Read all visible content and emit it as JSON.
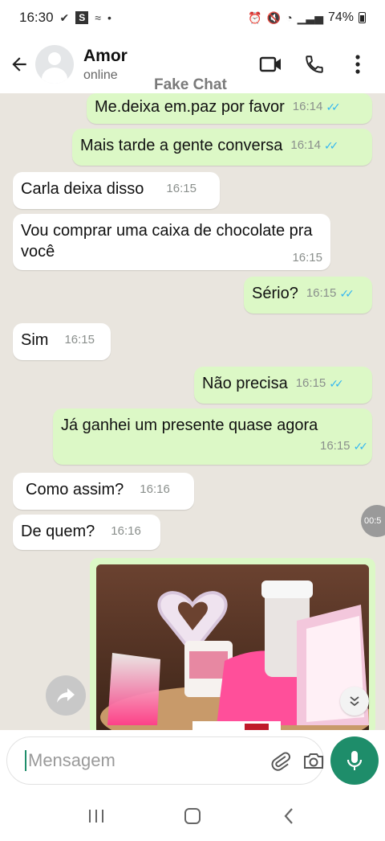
{
  "status_bar": {
    "time": "16:30",
    "battery": "74%"
  },
  "header": {
    "contact_name": "Amor",
    "contact_status": "online",
    "watermark": "Fake Chat"
  },
  "messages": [
    {
      "direction": "out",
      "text": "Me.deixa em.paz por favor",
      "time": "16:14",
      "read": true
    },
    {
      "direction": "out",
      "text": "Mais tarde a gente conversa",
      "time": "16:14",
      "read": true
    },
    {
      "direction": "in",
      "text": "Carla deixa disso",
      "time": "16:15"
    },
    {
      "direction": "in",
      "text": "Vou comprar uma caixa de chocolate pra você",
      "time": "16:15"
    },
    {
      "direction": "out",
      "text": "Sério?",
      "time": "16:15",
      "read": true
    },
    {
      "direction": "in",
      "text": "Sim",
      "time": "16:15"
    },
    {
      "direction": "out",
      "text": "Não precisa",
      "time": "16:15",
      "read": true
    },
    {
      "direction": "out",
      "text": "Já ganhei um presente quase agora",
      "time": "16:15",
      "read": true
    },
    {
      "direction": "in",
      "text": "Como assim?",
      "time": "16:16"
    },
    {
      "direction": "in",
      "text": "De quem?",
      "time": "16:16"
    }
  ],
  "side_pill": "00:5",
  "composer": {
    "placeholder": "Mensagem"
  },
  "colors": {
    "outgoing_bubble": "#dcf8c6",
    "incoming_bubble": "#ffffff",
    "chat_background": "#e9e5de",
    "accent": "#1e8d6a",
    "read_ticks": "#34b7f1"
  },
  "icons": [
    "back-arrow-icon",
    "video-call-icon",
    "phone-icon",
    "more-vert-icon",
    "emoji-icon",
    "attach-icon",
    "camera-icon",
    "mic-icon",
    "forward-icon",
    "scroll-down-icon",
    "recents-icon",
    "home-icon",
    "back-nav-icon"
  ]
}
